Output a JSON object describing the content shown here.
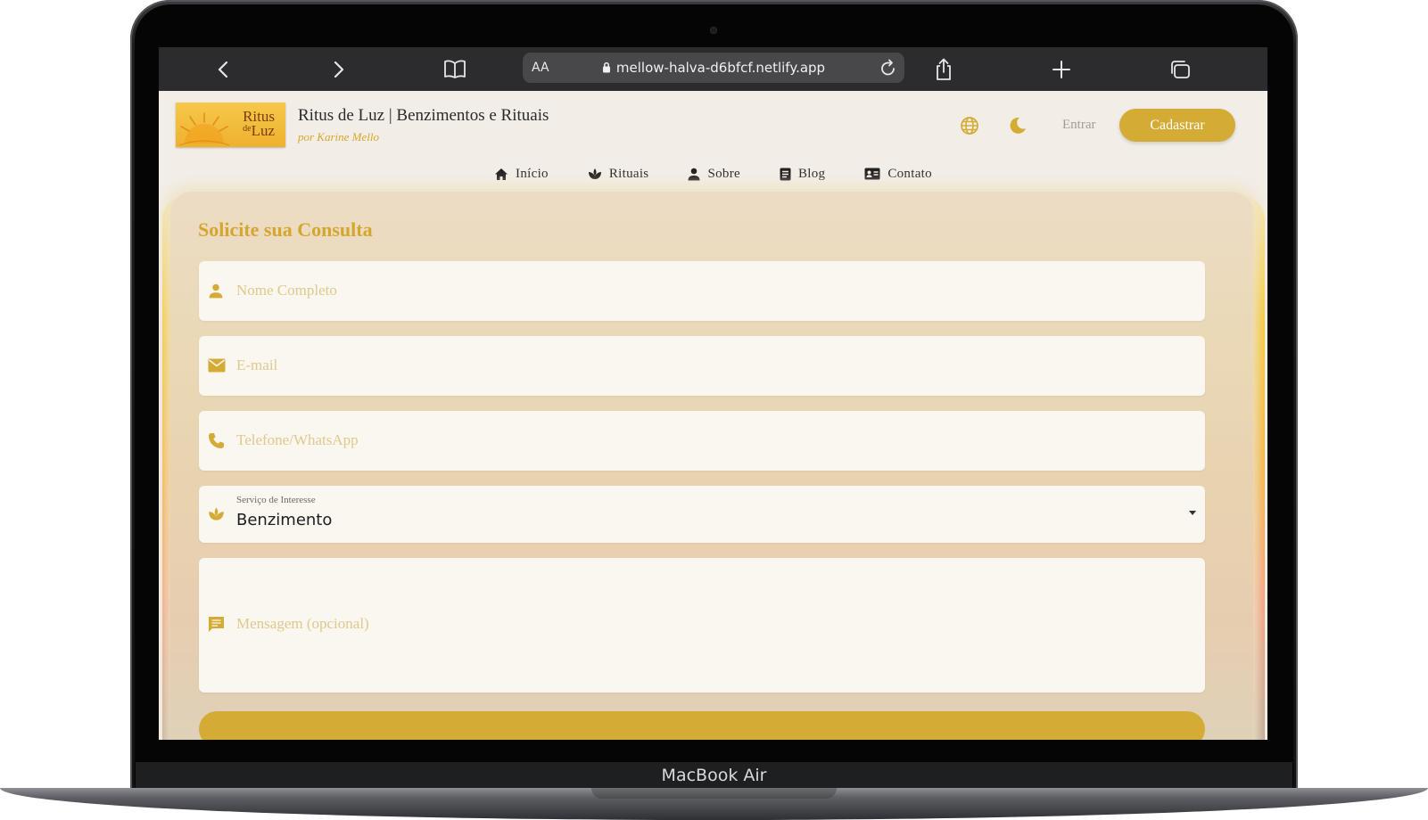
{
  "device": {
    "label": "MacBook Air"
  },
  "browser": {
    "aa_label": "AA",
    "url": "mellow-halva-d6bfcf.netlify.app"
  },
  "site": {
    "logo_line1": "Ritus",
    "logo_de": "de",
    "logo_line2": "Luz",
    "title": "Ritus de Luz | Benzimentos e Rituais",
    "subtitle": "por Karine Mello",
    "entrar": "Entrar",
    "cadastrar": "Cadastrar"
  },
  "nav": {
    "items": [
      {
        "label": "Início",
        "icon": "home-icon"
      },
      {
        "label": "Rituais",
        "icon": "lotus-icon"
      },
      {
        "label": "Sobre",
        "icon": "person-icon"
      },
      {
        "label": "Blog",
        "icon": "article-icon"
      },
      {
        "label": "Contato",
        "icon": "contact-card-icon"
      }
    ]
  },
  "form": {
    "title": "Solicite sua Consulta",
    "name_placeholder": "Nome Completo",
    "email_placeholder": "E-mail",
    "phone_placeholder": "Telefone/WhatsApp",
    "service_label": "Serviço de Interesse",
    "service_value": "Benzimento",
    "message_placeholder": "Mensagem (opcional)"
  },
  "colors": {
    "accent": "#d4ab35",
    "placeholder": "#e0c98c",
    "toolbar": "#2c2c2e"
  }
}
